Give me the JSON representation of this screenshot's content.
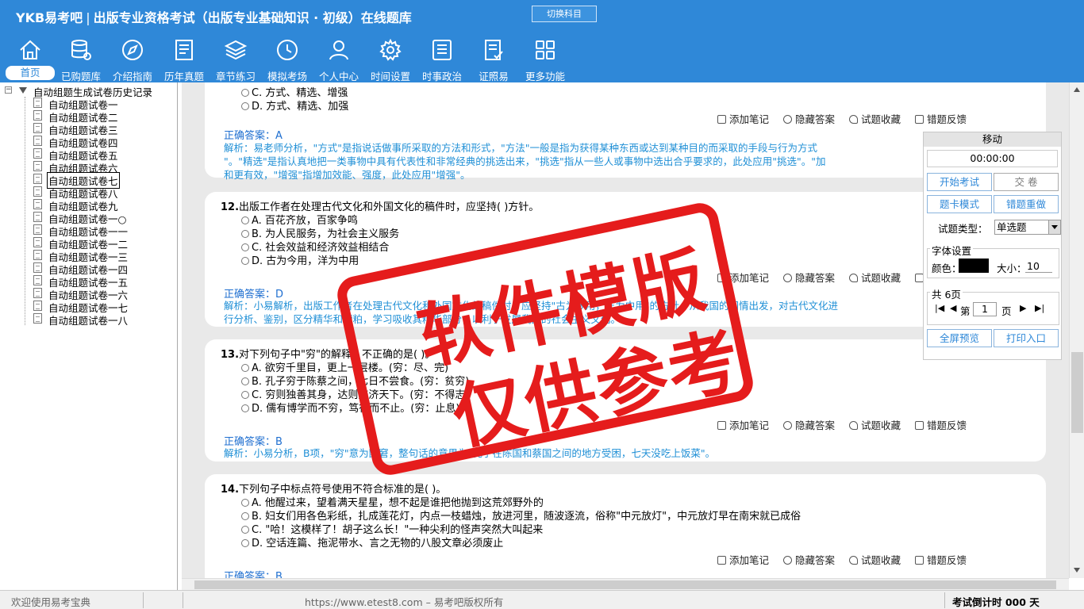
{
  "header": {
    "brand": "YKB易考吧",
    "title": "出版专业资格考试（出版专业基础知识 · 初级）在线题库",
    "switch_label": "切换科目"
  },
  "nav": [
    {
      "label": "首页",
      "icon": "home-icon"
    },
    {
      "label": "已购题库",
      "icon": "database-icon"
    },
    {
      "label": "介绍指南",
      "icon": "compass-icon"
    },
    {
      "label": "历年真题",
      "icon": "document-icon"
    },
    {
      "label": "章节练习",
      "icon": "layers-icon"
    },
    {
      "label": "模拟考场",
      "icon": "clock-icon"
    },
    {
      "label": "个人中心",
      "icon": "user-icon"
    },
    {
      "label": "时间设置",
      "icon": "gear-icon"
    },
    {
      "label": "时事政治",
      "icon": "news-icon"
    },
    {
      "label": "证照易",
      "icon": "certificate-icon"
    },
    {
      "label": "更多功能",
      "icon": "grid-icon"
    }
  ],
  "sidebar": {
    "root": "自动组题生成试卷历史记录",
    "items": [
      "自动组题试卷一",
      "自动组题试卷二",
      "自动组题试卷三",
      "自动组题试卷四",
      "自动组题试卷五",
      "自动组题试卷六",
      "自动组题试卷七",
      "自动组题试卷八",
      "自动组题试卷九",
      "自动组题试卷一○",
      "自动组题试卷一一",
      "自动组题试卷一二",
      "自动组题试卷一三",
      "自动组题试卷一四",
      "自动组题试卷一五",
      "自动组题试卷一六",
      "自动组题试卷一七",
      "自动组题试卷一八"
    ]
  },
  "tools": {
    "note": "添加笔记",
    "hide": "隐藏答案",
    "fav": "试题收藏",
    "feedback": "错题反馈"
  },
  "answer_label": "正确答案：",
  "questions": [
    {
      "options": [
        "C. 方式、精选、增强",
        "D. 方式、精选、加强"
      ],
      "answer": "A",
      "explanation": [
        "解析：易老师分析，\"方式\"是指说话做事所采取的方法和形式，\"方法\"一般是指为获得某种东西或达到某种目的而采取的手段与行为方式",
        "\"。\"精选\"是指认真地把一类事物中具有代表性和非常经典的挑选出来，\"挑选\"指从一些人或事物中选出合乎要求的，此处应用\"挑选\"。\"加",
        "和更有效，\"增强\"指增加效能、强度，此处应用\"增强\"。"
      ]
    },
    {
      "num": "12.",
      "title": "出版工作者在处理古代文化和外国文化的稿件时，应坚持(  )方针。",
      "options": [
        "A. 百花齐放，百家争鸣",
        "B. 为人民服务，为社会主义服务",
        "C. 社会效益和经济效益相结合",
        "D. 古为今用，洋为中用"
      ],
      "answer": "D",
      "explanation": [
        "解析：小易解析，出版工作者在处理古代文化和外国文化的稿件时，应坚持\"古为今用，洋为中用\"的方针，从我国的国情出发，对古代文化进",
        "行分析、鉴别，区分精华和糟粕，学习吸收其精华部分，以利于发展我国的社会主义文化。"
      ]
    },
    {
      "num": "13.",
      "title": "对下列句子中\"穷\"的解释，不正确的是(  )。",
      "options": [
        "A. 欲穷千里目，更上一层楼。(穷：尽、完)",
        "B. 孔子穷于陈蔡之间，七日不尝食。(穷：贫穷)",
        "C. 穷则独善其身，达则兼济天下。(穷：不得志)",
        "D. 儒有博学而不穷，笃行而不止。(穷：止息)"
      ],
      "answer": "B",
      "explanation": [
        "解析：小易分析，B项，\"穷\"意为困窘，整句话的意思为\"孔子在陈国和蔡国之间的地方受困，七天没吃上饭菜\"。"
      ]
    },
    {
      "num": "14.",
      "title": "下列句子中标点符号使用不符合标准的是(  )。",
      "options": [
        "A. 他醒过来，望着满天星星，想不起是谁把他抛到这荒郊野外的",
        "B. 妇女们用各色彩纸，扎成莲花灯，内点一枝蜡烛，放进河里，随波逐流，俗称\"中元放灯\"，中元放灯早在南宋就已成俗",
        "C. \"哈！这模样了！胡子这么长！\"一种尖利的怪声突然大叫起来",
        "D. 空话连篇、拖泥带水、言之无物的八股文章必须废止"
      ],
      "answer": "B"
    }
  ],
  "panel": {
    "title": "移动",
    "timer": "00:00:00",
    "start": "开始考试",
    "submit": "交    卷",
    "card_mode": "题卡模式",
    "redo": "错题重做",
    "type_label": "试题类型：",
    "type_value": "单选题",
    "font_group": "字体设置",
    "color_label": "颜色：",
    "size_label": "大小：",
    "size_value": "10",
    "pages": "共 6页",
    "page_prefix": "第",
    "page_value": "1",
    "page_suffix": "页",
    "fullscreen": "全屏预览",
    "print": "打印入口"
  },
  "status": {
    "left": "欢迎使用易考宝典",
    "center": "https://www.etest8.com – 易考吧版权所有",
    "right": "考试倒计时 000 天"
  },
  "watermark": {
    "line1": "软件模版",
    "line2": "仅供参考"
  },
  "colors": {
    "header": "#2f88d8",
    "answer": "#1f6fd0",
    "watermark": "#e51c1c"
  }
}
